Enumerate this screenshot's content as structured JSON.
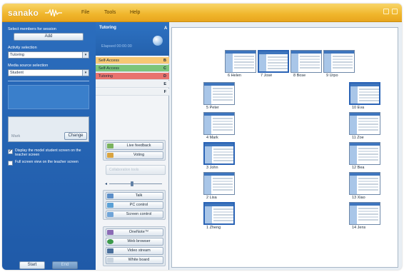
{
  "app": {
    "logo": "sanako",
    "menu": [
      "File",
      "Tools",
      "Help"
    ]
  },
  "left_panel": {
    "select_members_label": "Select members for session",
    "add_button": "Add",
    "activity_label": "Activity selection",
    "activity_value": "Tutoring",
    "media_label": "Media source selection",
    "media_value": "Student",
    "model_student_name": "Mark",
    "change_button": "Change",
    "option_display_model": "Display the model student screen on the teacher screen",
    "option_display_model_checked": true,
    "option_fullscreen": "Full screen view on the teacher screen",
    "option_fullscreen_checked": false,
    "start_button": "Start",
    "end_button": "End"
  },
  "session": {
    "title": "Tutoring",
    "letter": "A",
    "time": "Elapsed 00:00:00",
    "groups": [
      {
        "name": "Self-Access",
        "letter": "B",
        "color": "#f7c873"
      },
      {
        "name": "Self-Access",
        "letter": "C",
        "color": "#7cc57a"
      },
      {
        "name": "Tutoring",
        "letter": "D",
        "color": "#e8736e"
      },
      {
        "name": "",
        "letter": "E"
      },
      {
        "name": "",
        "letter": "F"
      }
    ]
  },
  "tools": {
    "feedback": [
      "Live feedback",
      "Voting"
    ],
    "sub_tab": "Collaboration tools",
    "actions": [
      "Talk",
      "PC control",
      "Screen control"
    ],
    "apps": [
      "OneNote™",
      "Web browser",
      "Video stream",
      "White board"
    ]
  },
  "classroom": {
    "students": [
      {
        "num": 6,
        "name": "Helen",
        "selected": false
      },
      {
        "num": 7,
        "name": "José",
        "selected": true
      },
      {
        "num": 8,
        "name": "Bose",
        "selected": false
      },
      {
        "num": 9,
        "name": "Urpo",
        "selected": false
      },
      {
        "num": 5,
        "name": "Peter",
        "selected": false
      },
      {
        "num": 4,
        "name": "Mark",
        "selected": false
      },
      {
        "num": 3,
        "name": "John",
        "selected": true
      },
      {
        "num": 2,
        "name": "Lisa",
        "selected": false
      },
      {
        "num": 1,
        "name": "Zheng",
        "selected": true
      },
      {
        "num": 10,
        "name": "Eva",
        "selected": true
      },
      {
        "num": 11,
        "name": "Zoe",
        "selected": false
      },
      {
        "num": 12,
        "name": "Bea",
        "selected": false
      },
      {
        "num": 13,
        "name": "Xiao",
        "selected": false
      },
      {
        "num": 14,
        "name": "Jens",
        "selected": false
      }
    ]
  },
  "colors": {
    "title_bar": "#f0b62c",
    "left_panel": "#2461ac",
    "selected_border": "#2a63b5"
  }
}
